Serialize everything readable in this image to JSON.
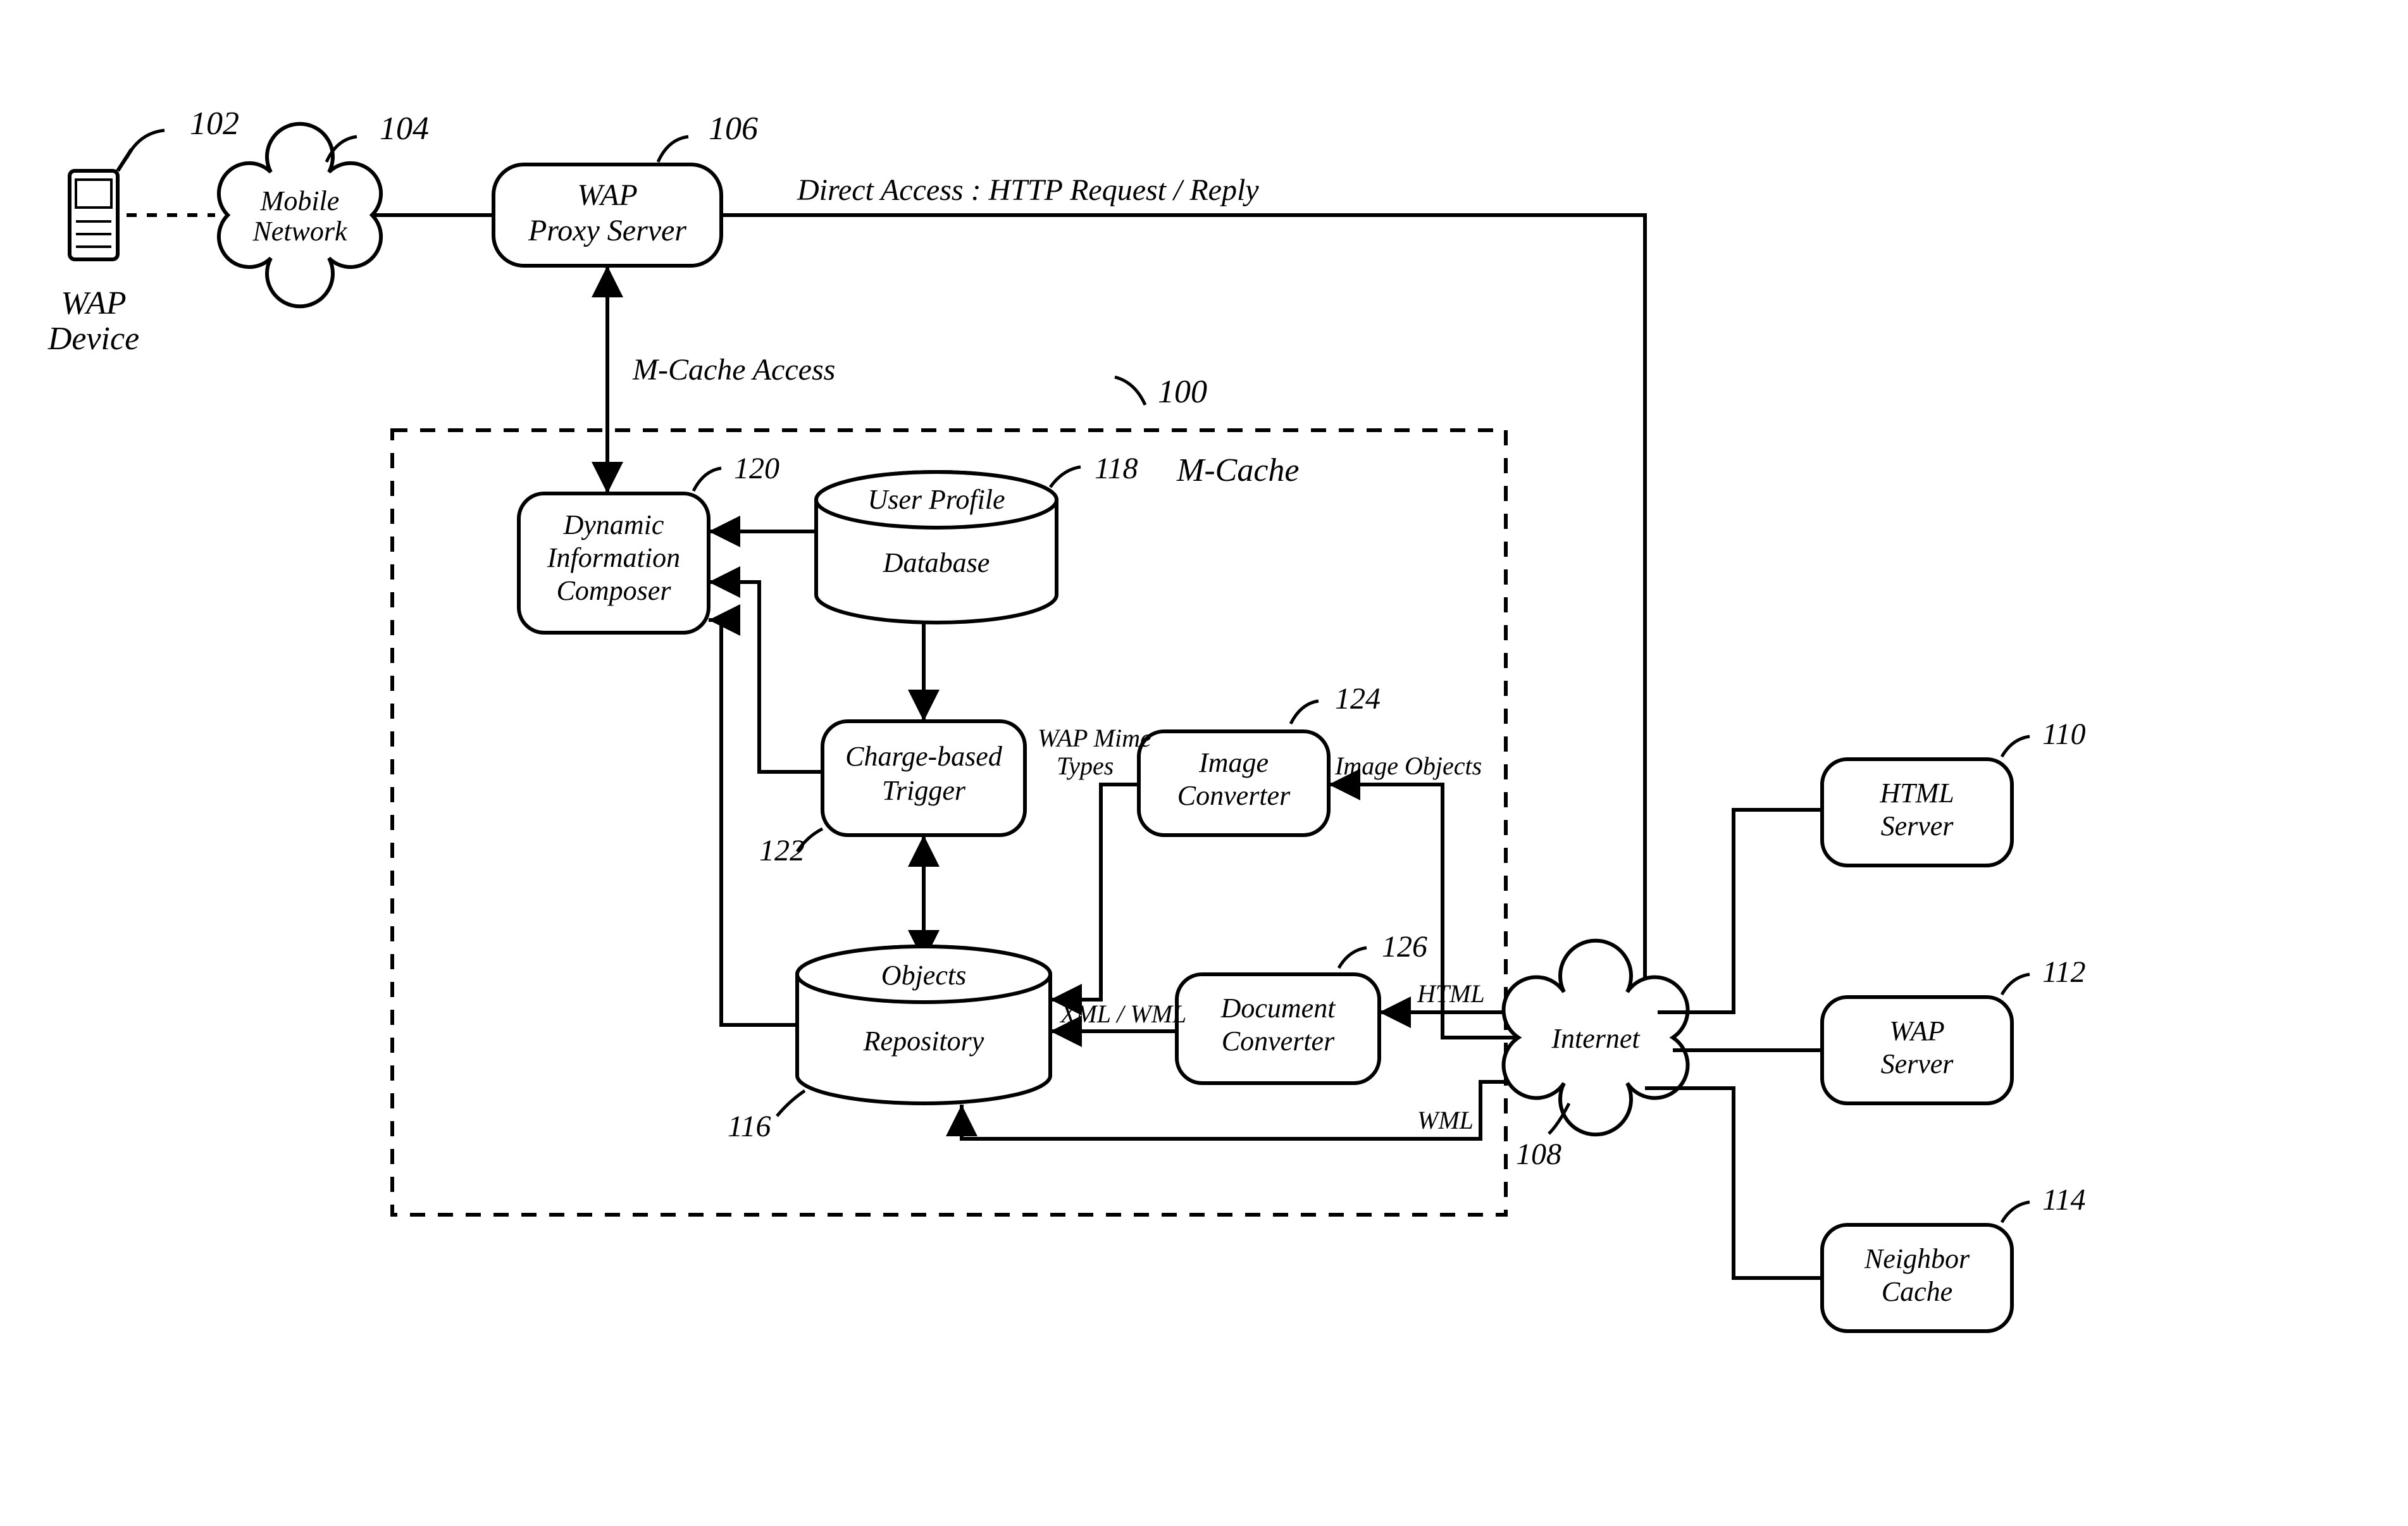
{
  "nodes": {
    "wap_device": {
      "label1": "WAP",
      "label2": "Device",
      "ref": "102"
    },
    "mobile_net": {
      "label1": "Mobile",
      "label2": "Network",
      "ref": "104"
    },
    "proxy": {
      "label1": "WAP",
      "label2": "Proxy Server",
      "ref": "106"
    },
    "mcache": {
      "title": "M-Cache",
      "ref": "100"
    },
    "dic": {
      "label1": "Dynamic",
      "label2": "Information",
      "label3": "Composer",
      "ref": "120"
    },
    "usr_db": {
      "label1": "User Profile",
      "label2": "Database",
      "ref": "118"
    },
    "trigger": {
      "label1": "Charge-based",
      "label2": "Trigger",
      "ref": "122"
    },
    "img_conv": {
      "label1": "Image",
      "label2": "Converter",
      "ref": "124"
    },
    "doc_conv": {
      "label1": "Document",
      "label2": "Converter",
      "ref": "126"
    },
    "obj_repo": {
      "label1": "Objects",
      "label2": "Repository",
      "ref": "116"
    },
    "internet": {
      "label": "Internet",
      "ref": "108"
    },
    "html_srv": {
      "label1": "HTML",
      "label2": "Server",
      "ref": "110"
    },
    "wap_srv": {
      "label1": "WAP",
      "label2": "Server",
      "ref": "112"
    },
    "nbr_cache": {
      "label1": "Neighbor",
      "label2": "Cache",
      "ref": "114"
    }
  },
  "edges": {
    "direct_access": "Direct Access : HTTP Request / Reply",
    "mcache_access": "M-Cache Access",
    "wap_mime": "WAP Mime",
    "wap_mime2": "Types",
    "img_objects": "Image Objects",
    "xml_wml": "XML / WML",
    "html": "HTML",
    "wml": "WML"
  }
}
